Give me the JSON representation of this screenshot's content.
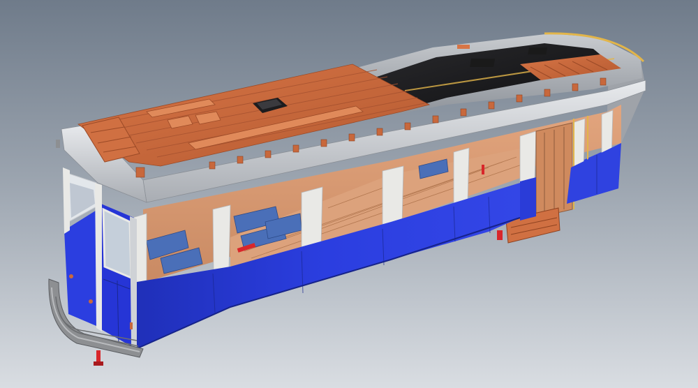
{
  "scene": {
    "kind": "3d-cad-render",
    "subject": "tram-car",
    "colors": {
      "background_top": "#6f7b8a",
      "background_bottom": "#d9dde2",
      "body_blue": "#2b3ee0",
      "body_blue_dark": "#1f2fb8",
      "roof_copper": "#c8683c",
      "roof_copper_light": "#e08a5a",
      "roof_gray": "#9a9fa6",
      "roof_dark": "#1c1c1e",
      "window_frame": "#e9e9e6",
      "interior_wood": "#d89a72",
      "seat_blue": "#4a6fb8",
      "rail_yellow": "#e2b54a",
      "bumper_gray": "#8d8f92",
      "coupler_red": "#d8262a"
    },
    "parts": [
      "roof",
      "roof-vent",
      "side-windows",
      "front-cab",
      "lower-body-panel",
      "door",
      "bumper",
      "coupler"
    ]
  }
}
